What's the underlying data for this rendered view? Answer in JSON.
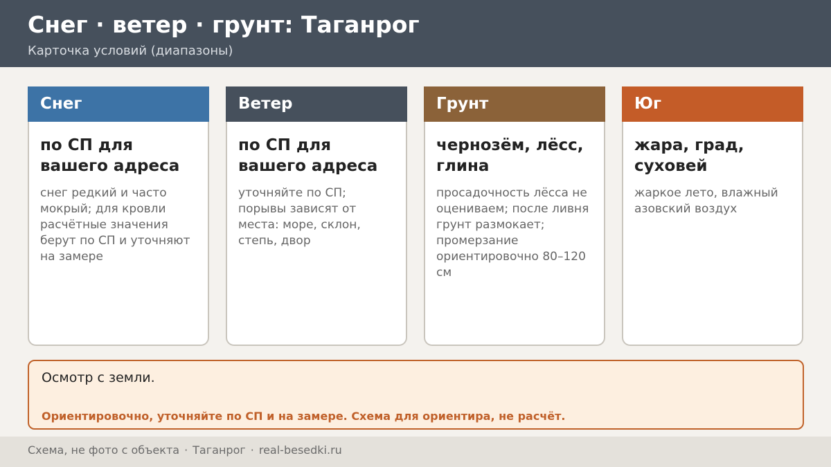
{
  "header": {
    "title": "Снег · ветер · грунт: Таганрог",
    "subtitle": "Карточка условий (диапазоны)"
  },
  "cards": [
    {
      "label": "Снег",
      "color": "#3d73a6",
      "main": "по СП для вашего адреса",
      "note": "снег редкий и часто мокрый; для кровли расчётные значения берут по СП и уточняют на замере"
    },
    {
      "label": "Ветер",
      "color": "#46505c",
      "main": "по СП для вашего адреса",
      "note": "уточняйте по СП; порывы зависят от места: море, склон, степь, двор"
    },
    {
      "label": "Грунт",
      "color": "#8b6239",
      "main": "чернозём, лёсс, глина",
      "note": "просадочность лёсса не оцениваем; после ливня грунт размокает; промерзание ориентировочно 80–120 см"
    },
    {
      "label": "Юг",
      "color": "#c45c28",
      "main": "жара, град, суховей",
      "note": "жаркое лето, влажный азовский воздух"
    }
  ],
  "notice": {
    "main": "Осмотр с земли.",
    "warning": "Ориентировочно, уточняйте по СП и на замере. Схема для ориентира, не расчёт."
  },
  "footer": {
    "items": [
      "Схема, не фото с объекта",
      "Таганрог",
      "real-besedki.ru"
    ],
    "separator": "·"
  }
}
